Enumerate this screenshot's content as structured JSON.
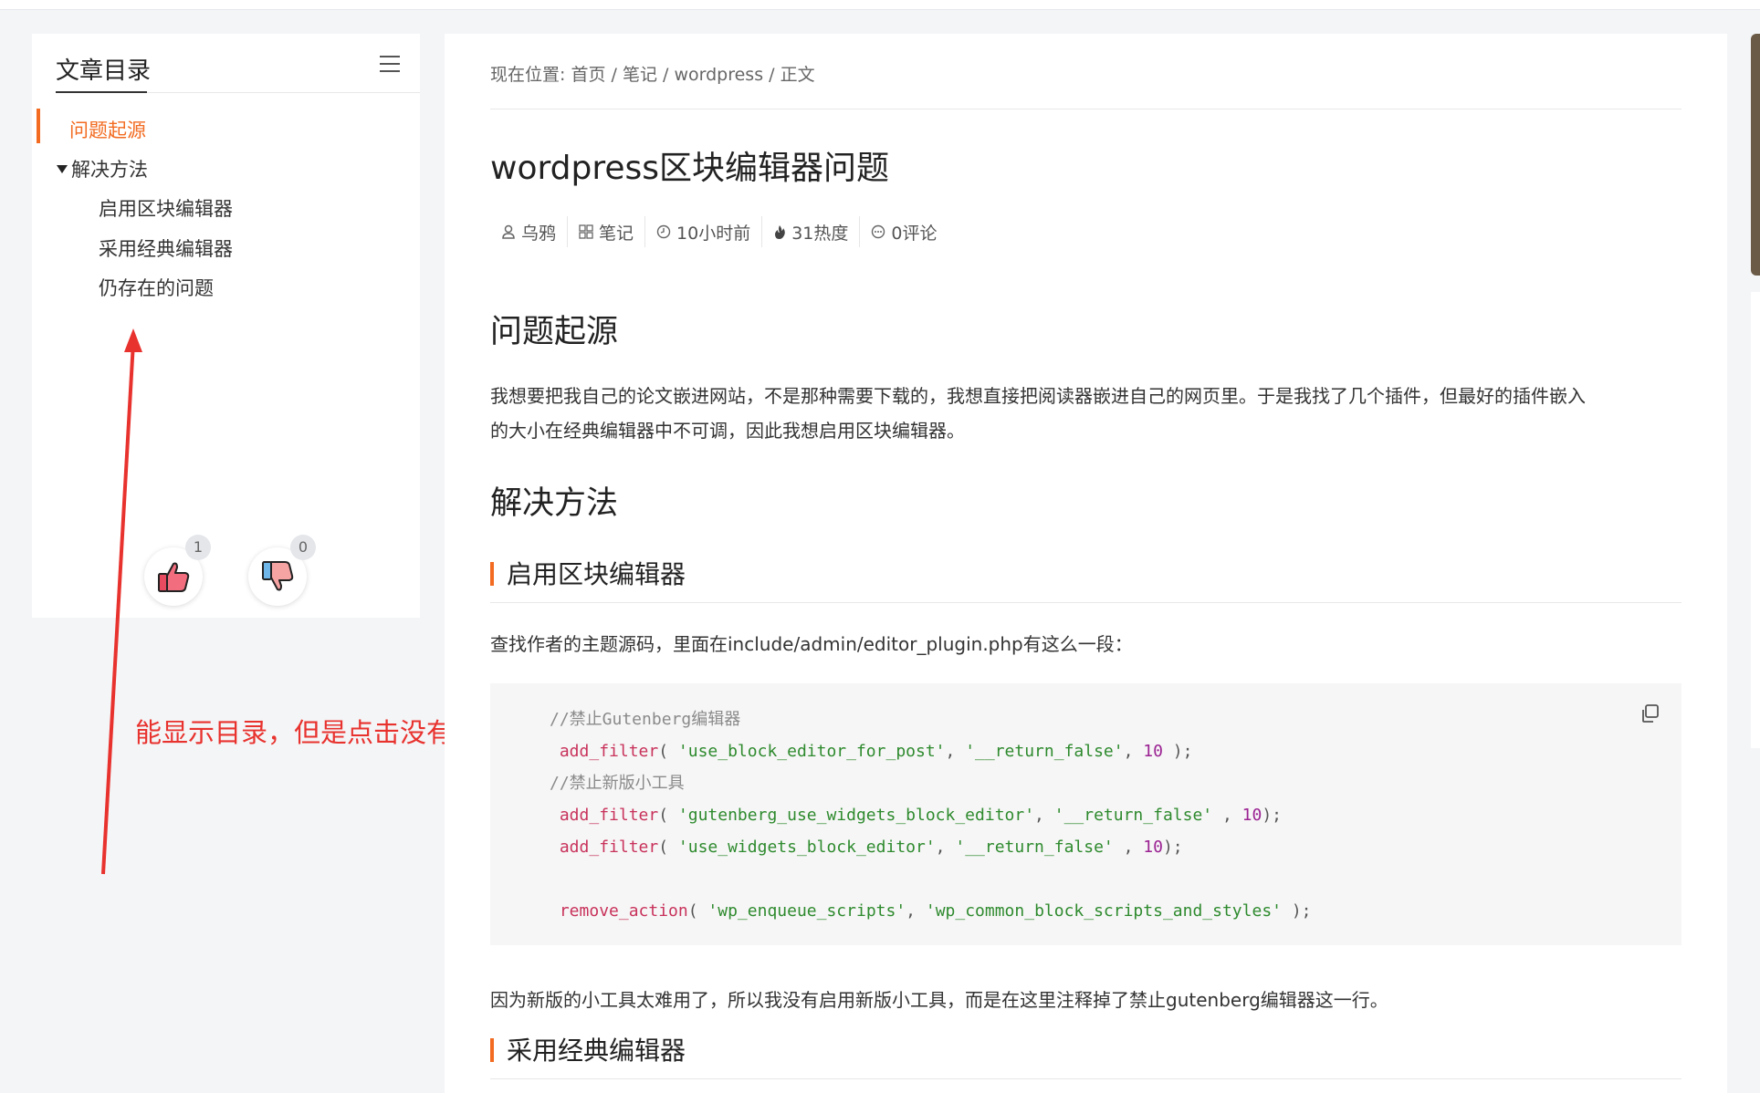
{
  "toc": {
    "title": "文章目录",
    "items": [
      {
        "label": "问题起源",
        "active": true
      },
      {
        "label": "解决方法"
      },
      {
        "label": "启用区块编辑器"
      },
      {
        "label": "采用经典编辑器"
      },
      {
        "label": "仍存在的问题"
      }
    ],
    "like_count": "1",
    "dislike_count": "0"
  },
  "annotation": {
    "text": "能显示目录，但是点击没有反应",
    "color": "#e8322e"
  },
  "breadcrumb": {
    "prefix": "现在位置: ",
    "home": "首页",
    "category": "笔记",
    "sub": "wordpress",
    "current": "正文",
    "sep": " / "
  },
  "article": {
    "title": "wordpress区块编辑器问题",
    "meta": {
      "author": "乌鸦",
      "category": "笔记",
      "time": "10小时前",
      "heat": "31热度",
      "comments": "0评论"
    },
    "h_origin": "问题起源",
    "p_origin_1": "我想要把我自己的论文嵌进网站，不是那种需要下载的，我想直接把阅读器嵌进自己的网页里。于是我找了几个插件，但最好的插件嵌入",
    "p_origin_2": "的大小在经典编辑器中不可调，因此我想启用区块编辑器。",
    "h_solution": "解决方法",
    "h_block": "启用区块编辑器",
    "p_block": "查找作者的主题源码，里面在include/admin/editor_plugin.php有这么一段：",
    "code": {
      "comment1": "//禁止Gutenberg编辑器",
      "fn_add_filter": "add_filter",
      "fn_remove_action": "remove_action",
      "s1": "'use_block_editor_for_post'",
      "s_return_false": "'__return_false'",
      "comment2": "//禁止新版小工具",
      "s2": "'gutenberg_use_widgets_block_editor'",
      "s3": "'use_widgets_block_editor'",
      "s4": "'wp_enqueue_scripts'",
      "s5": "'wp_common_block_scripts_and_styles'",
      "num": "10"
    },
    "p_after_code": "因为新版的小工具太难用了，所以我没有启用新版小工具，而是在这里注释掉了禁止gutenberg编辑器这一行。",
    "h_classic": "采用经典编辑器"
  },
  "colors": {
    "accent": "#f26b21",
    "annotation": "#e8322e"
  }
}
